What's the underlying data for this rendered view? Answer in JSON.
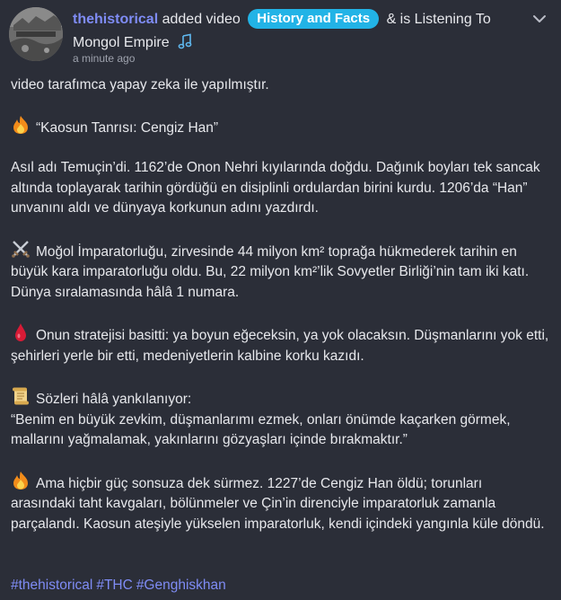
{
  "post": {
    "username": "thehistorical",
    "action_text": "added video",
    "group_name": "History and Facts",
    "connector": "& is Listening To",
    "listening_to": "Mongol Empire",
    "timestamp": "a minute ago",
    "avatar_text": "thehistorical",
    "intro": "video tarafımca yapay zeka ile yapılmıştır.",
    "title": "“Kaosun Tanrısı: Cengiz Han”",
    "p1": "Asıl adı Temuçin’di. 1162’de Onon Nehri kıyılarında doğdu. Dağınık boyları tek sancak altında toplayarak tarihin gördüğü en disiplinli ordulardan birini kurdu. 1206’da “Han” unvanını aldı ve dünyaya korkunun adını yazdırdı.",
    "p2": "Moğol İmparatorluğu, zirvesinde 44 milyon km² toprağa hükmederek tarihin en büyük kara imparatorluğu oldu. Bu, 22 milyon km²’lik Sovyetler Birliği’nin tam iki katı. Dünya sıralamasında hâlâ 1 numara.",
    "p3": "Onun stratejisi basitti: ya boyun eğeceksin, ya yok olacaksın. Düşmanlarını yok etti, şehirleri yerle bir etti, medeniyetlerin kalbine korku kazıdı.",
    "p4_line1": "Sözleri hâlâ yankılanıyor:",
    "p4_quote": "“Benim en büyük zevkim, düşmanlarımı ezmek, onları önümde kaçarken görmek, mallarını yağmalamak, yakınlarını gözyaşları içinde bırakmaktır.”",
    "p5": "Ama hiçbir güç sonsuza dek sürmez. 1227’de Cengiz Han öldü; torunları arasındaki taht kavgaları, bölünmeler ve Çin’in direnciyle imparatorluk zamanla parçalandı. Kaosun ateşiyle yükselen imparatorluk, kendi içindeki yangınla küle döndü.",
    "hashtags": [
      "#thehistorical",
      "#THC",
      "#Genghiskhan"
    ]
  },
  "icons": {
    "music": "music-note-icon",
    "menu": "chevron-down-icon",
    "title_emoji": "fire-icon",
    "p2_emoji": "crossed-swords-icon",
    "p3_emoji": "drop-of-blood-icon",
    "p4_emoji": "scroll-icon",
    "p5_emoji": "fire-icon"
  },
  "colors": {
    "background": "#2b2e38",
    "username": "#7f8cf5",
    "group_pill": "#22b3e6",
    "hashtag": "#7f8cf5",
    "text": "#e7e8ec",
    "muted": "#9ea2ad"
  }
}
